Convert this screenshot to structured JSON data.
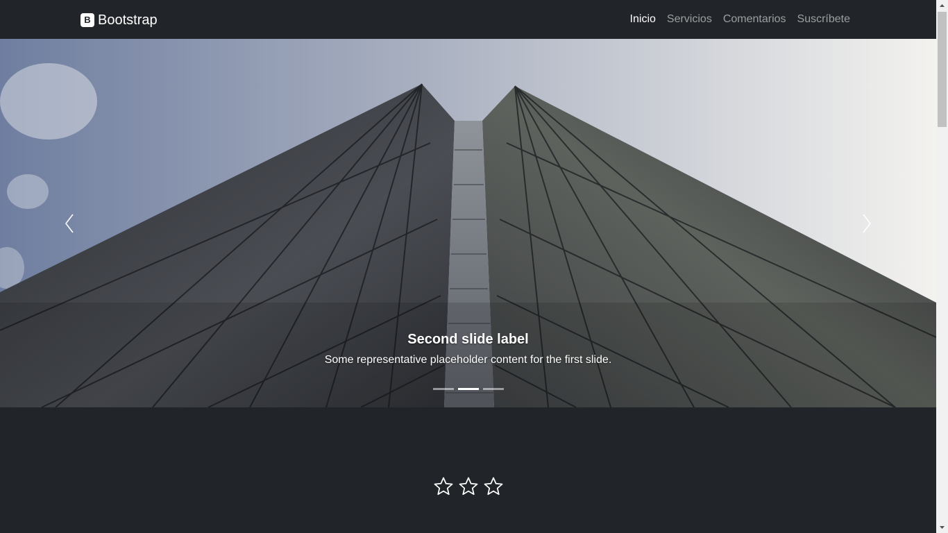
{
  "navbar": {
    "brand_icon": "B",
    "brand": "Bootstrap",
    "links": [
      {
        "label": "Inicio",
        "active": true
      },
      {
        "label": "Servicios",
        "active": false
      },
      {
        "label": "Comentarios",
        "active": false
      },
      {
        "label": "Suscríbete",
        "active": false
      }
    ]
  },
  "carousel": {
    "caption_title": "Second slide label",
    "caption_text": "Some representative placeholder content for the first slide.",
    "slides_count": 3,
    "active_index": 1,
    "prev_icon": "chevron-left-icon",
    "next_icon": "chevron-right-icon"
  },
  "rating": {
    "icon": "star-outline-icon",
    "count": 3
  },
  "colors": {
    "page_bg": "#212529",
    "nav_active": "#ffffff",
    "nav_inactive": "rgba(255,255,255,0.55)"
  }
}
